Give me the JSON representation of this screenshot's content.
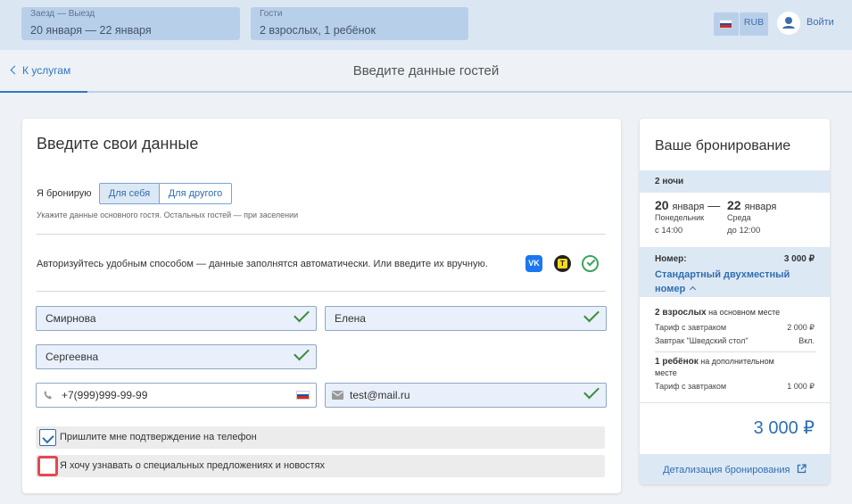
{
  "topbar": {
    "checkin_label": "Заезд — Выезд",
    "checkin_value": "20 января — 22 января",
    "guests_label": "Гости",
    "guests_value": "2 взрослых, 1 ребёнок",
    "currency": "RUB",
    "login": "Войти",
    "flag_colors": [
      "#ffffff",
      "#1c4fb3",
      "#d52b1e"
    ]
  },
  "subheader": {
    "back": "К услугам",
    "title": "Введите данные гостей"
  },
  "form": {
    "title": "Введите свои данные",
    "booking_for_label": "Я бронирую",
    "option_self": "Для себя",
    "option_other": "Для другого",
    "hint": "Укажите данные основного гостя. Остальных гостей — при заселении",
    "auth_text": "Авторизуйтесь удобным способом — данные заполнятся автоматически. Или введите их вручную.",
    "vk_icon_label": "VK",
    "yandex_icon_label": "Т",
    "last_name": "Смирнова",
    "first_name": "Елена",
    "middle_name": "Сергеевна",
    "phone": "+7(999)999-99-99",
    "email": "test@mail.ru",
    "checkbox_phone": "Пришлите мне подтверждение на телефон",
    "checkbox_phone_checked": true,
    "checkbox_news": "Я хочу узнавать о специальных предложениях и новостях",
    "checkbox_news_checked": false
  },
  "summary": {
    "title": "Ваше бронирование",
    "nights": "2 ночи",
    "checkin_day": "20",
    "checkin_month": "января",
    "dash": "—",
    "checkout_day": "22",
    "checkout_month": "января",
    "checkin_weekday": "Понедельник",
    "checkout_weekday": "Среда",
    "checkin_time": "с 14:00",
    "checkout_time": "до 12:00",
    "room_label": "Номер:",
    "room_price": "3 000 ₽",
    "room_name_line1": "Стандартный двухместный",
    "room_name_line2": "номер",
    "adults_bold": "2 взрослых",
    "adults_rest": " на основном месте",
    "tariff1": "Тариф с завтраком",
    "tariff1_price": "2 000 ₽",
    "breakfast": "Завтрак \"Шведский стол\"",
    "breakfast_value": "Вкл.",
    "child_bold": "1 ребёнок",
    "child_rest": " на дополнительном",
    "child_rest2": "месте",
    "tariff2": "Тариф с завтраком",
    "tariff2_price": "1 000 ₽",
    "total": "3 000 ₽",
    "details_link": "Детализация бронирования"
  }
}
